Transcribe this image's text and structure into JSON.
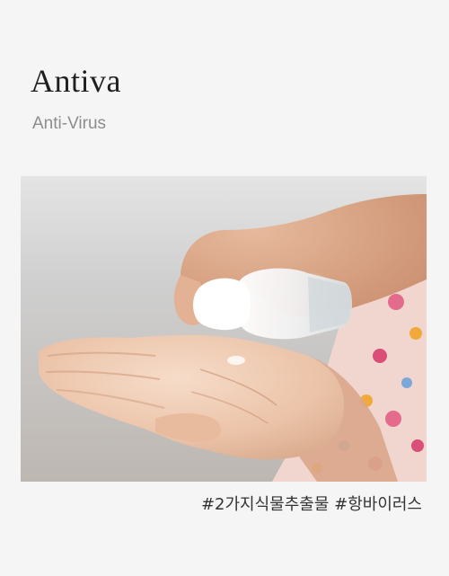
{
  "brand": {
    "title": "Antiva",
    "subtitle": "Anti-Virus"
  },
  "photo": {
    "icon": "hand-sanitizer-photo"
  },
  "caption": {
    "text": "#2가지식물추출물 #항바이러스"
  },
  "colors": {
    "background": "#f5f5f5",
    "title": "#1f1f1f",
    "subtitle": "#8d8d8d",
    "caption": "#333333"
  }
}
